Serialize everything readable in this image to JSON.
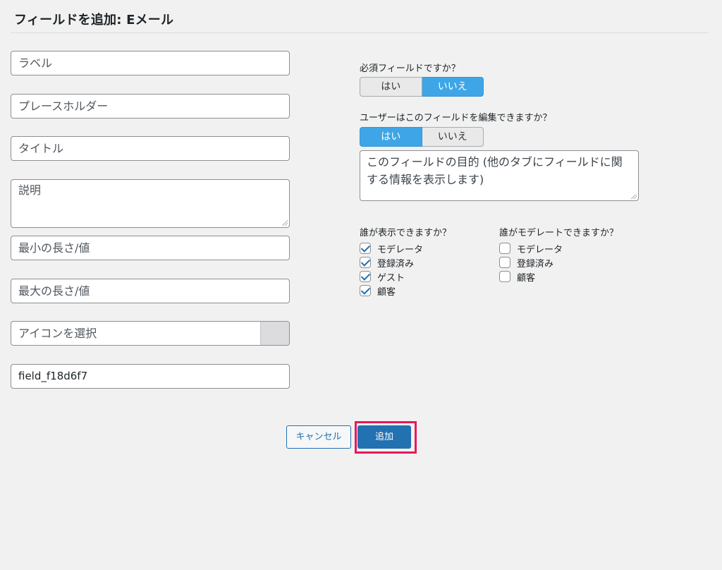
{
  "header": {
    "title": "フィールドを追加: Eメール"
  },
  "left_fields": {
    "label_placeholder": "ラベル",
    "placeholder_placeholder": "プレースホルダー",
    "title_placeholder": "タイトル",
    "description_placeholder": "説明",
    "min_length_placeholder": "最小の長さ/値",
    "max_length_placeholder": "最大の長さ/値",
    "icon_select_placeholder": "アイコンを選択",
    "field_key_value": "field_f18d6f7"
  },
  "required_question": {
    "label": "必須フィールドですか？",
    "options": [
      "はい",
      "いいえ"
    ],
    "selected": "いいえ"
  },
  "editable_question": {
    "label": "ユーザーはこのフィールドを編集できますか？",
    "options": [
      "はい",
      "いいえ"
    ],
    "selected": "はい"
  },
  "purpose": {
    "placeholder": "このフィールドの目的 (他のタブにフィールドに関する情報を表示します)"
  },
  "visible_to": {
    "label": "誰が表示できますか？",
    "items": [
      {
        "label": "モデレータ",
        "checked": true
      },
      {
        "label": "登録済み",
        "checked": true
      },
      {
        "label": "ゲスト",
        "checked": true
      },
      {
        "label": "顧客",
        "checked": true
      }
    ]
  },
  "moderated_by": {
    "label": "誰がモデレートできますか？",
    "items": [
      {
        "label": "モデレータ",
        "checked": false
      },
      {
        "label": "登録済み",
        "checked": false
      },
      {
        "label": "顧客",
        "checked": false
      }
    ]
  },
  "actions": {
    "cancel_label": "キャンセル",
    "add_label": "追加"
  },
  "colors": {
    "primary": "#2271b1",
    "toggle_active": "#3ea6e6",
    "highlight": "#e8185a",
    "background": "#f1f1f1"
  }
}
